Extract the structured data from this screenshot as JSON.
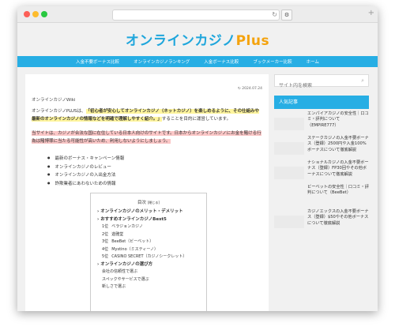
{
  "colors": {
    "accent": "#27aee4",
    "logo_blue": "#1fa6dc",
    "logo_plus": "#f4a30e"
  },
  "site": {
    "logo_main": "オンラインカジノ",
    "logo_plus": "Plus"
  },
  "nav": [
    "入金不要ボーナス比較",
    "オンラインカジノランキング",
    "入金ボーナス比較",
    "ブックメーカー比較",
    "ホーム"
  ],
  "article": {
    "date": "2024.07.24",
    "breadcrumb": "オンラインカジノWiki",
    "intro_prefix": "オンラインカジノPLUSは、",
    "intro_highlight": "「初心者が安心してオンラインカジノ（ネットカジノ）を楽しめるように、その仕組みや最新のオンラインカジノの情報などを明確で理解しやすく紹介。」",
    "intro_suffix": "することを目的に運営しています。",
    "notice": "当サイトは、カジノが合法な国に在住している日本人向けのサイトです。日本からオンラインカジノにお金を賭ける行為は賭博罪に当たる可能性が高いため、利用しないようにしましょう。",
    "bullets": [
      "最新のボーナス・キャンペーン情報",
      "オンラインカジノのレビュー",
      "オンラインカジノの入出金方法",
      "詐欺業者にあわないための情報"
    ]
  },
  "toc": {
    "title": "目次",
    "toggle": "[閉じる]",
    "h2_1": "オンラインカジノのメリット・デメリット",
    "h2_2": "おすすめオンラインカジノBest5",
    "rank": [
      {
        "num": "1位",
        "name": "ベラジョンカジノ"
      },
      {
        "num": "2位",
        "name": "遊雅堂"
      },
      {
        "num": "3位",
        "name": "BeeBet（ビーベット）"
      },
      {
        "num": "4位",
        "name": "Mystino（ミスティーノ）"
      },
      {
        "num": "5位",
        "name": "CASINO SECRET（カジノシークレット）"
      }
    ],
    "h2_3": "オンラインカジノの選び方",
    "sub": [
      "会社の信頼性で選ぶ",
      "スペックやサービスで選ぶ",
      "新しさで選ぶ"
    ]
  },
  "sidebar": {
    "search_placeholder": "サイト内を検索",
    "search_icon": "search-icon",
    "popular_title": "人気記事",
    "popular": [
      "エンパイアカジノの安全性｜口コミ・評判について（EMPIRE777）",
      "ステークカジノの入金不要ボーナス（登録）2500円や入金100%ボーナスについて徹底解説",
      "ナショナルカジノの入金不要ボーナス（登録）FP30回やその他ボーナスについて徹底解説",
      "ビーベットの安全性｜口コミ・評判について（BeeBet）",
      "カジノエックスの入金不要ボーナス（登録）$50やその他ボーナスについて徹底解説"
    ]
  }
}
